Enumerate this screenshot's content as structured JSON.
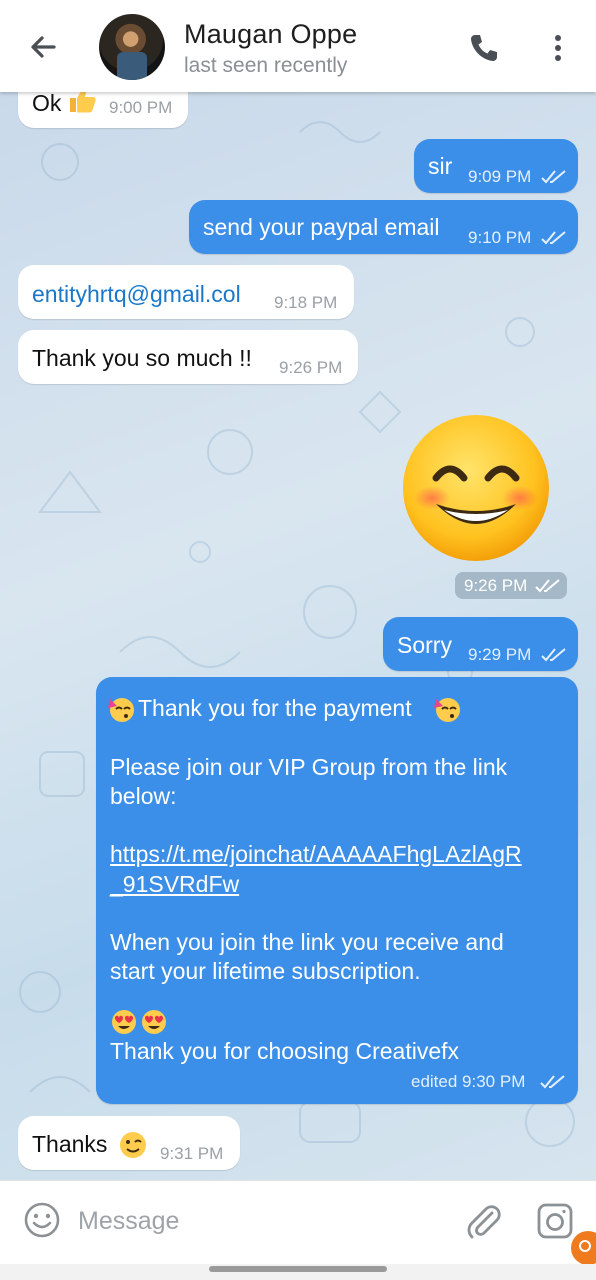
{
  "header": {
    "contact_name": "Maugan Oppe",
    "status": "last seen recently"
  },
  "messages": [
    {
      "id": "m1",
      "direction": "in",
      "text": "Ok",
      "emoji": "thumbs-up",
      "time": "9:00 PM"
    },
    {
      "id": "m2",
      "direction": "out",
      "text": "sir",
      "time": "9:09 PM",
      "read": true
    },
    {
      "id": "m3",
      "direction": "out",
      "text": "send your paypal email",
      "time": "9:10 PM",
      "read": true
    },
    {
      "id": "m4",
      "direction": "in",
      "text": "entityhrtq@gmail.col",
      "time": "9:18 PM",
      "is_link": true
    },
    {
      "id": "m5",
      "direction": "in",
      "text": "Thank you so much !!",
      "time": "9:26 PM"
    },
    {
      "id": "m6",
      "direction": "out",
      "type": "sticker",
      "sticker": "smiling-face-with-smiling-eyes",
      "time": "9:26 PM",
      "read": true
    },
    {
      "id": "m7",
      "direction": "out",
      "text": "Sorry",
      "time": "9:29 PM",
      "read": true
    },
    {
      "id": "m8",
      "direction": "out",
      "line1": "Thank you for the payment",
      "line2": "Please join our VIP Group from the link",
      "line3": "below:",
      "link1": "https://t.me/joinchat/AAAAAFhgLAzlAgR",
      "link2": "_91SVRdFw",
      "line4": "When you join the link you receive and",
      "line5": "start your lifetime subscription.",
      "line6": "Thank you for choosing Creativefx",
      "time": "edited 9:30 PM",
      "read": true
    },
    {
      "id": "m9",
      "direction": "in",
      "text": "Thanks",
      "emoji": "winking-face",
      "time": "9:31 PM"
    }
  ],
  "input": {
    "placeholder": "Message"
  },
  "colors": {
    "outgoing_bubble": "#3c8fe8",
    "incoming_bubble": "#ffffff",
    "link": "#1a77c9",
    "chat_background": "#cfdfec"
  }
}
